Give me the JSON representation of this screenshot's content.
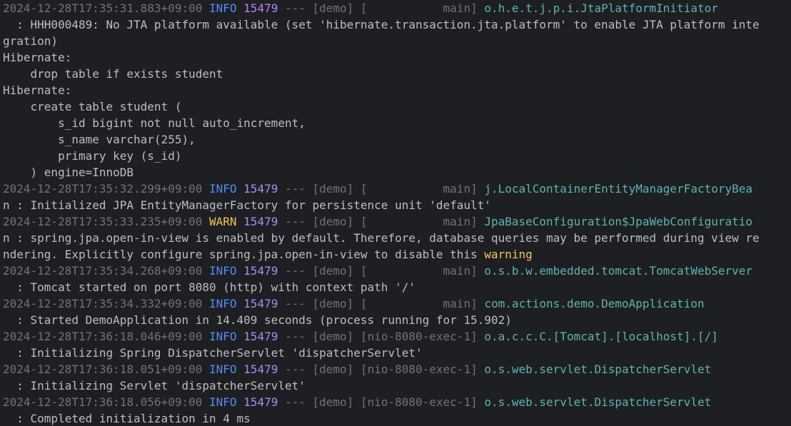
{
  "colors": {
    "background": "#1e1f22",
    "text": "#bcbec4",
    "timestamp": "#6f737a",
    "info": "#548af7",
    "warn": "#f2c55c",
    "pid": "#b189f5",
    "logger": "#5fb3b3"
  },
  "lines": [
    {
      "kind": "log",
      "ts": "2024-12-28T17:35:31.883+09:00",
      "level": "INFO",
      "level_pad": " INFO",
      "pid": "15479",
      "sep": "--- [demo] [",
      "thread": "           main]",
      "logger": "o.h.e.t.j.p.i.JtaPlatformInitiator"
    },
    {
      "kind": "text",
      "text": "  : HHH000489: No JTA platform available (set 'hibernate.transaction.jta.platform' to enable JTA platform inte"
    },
    {
      "kind": "text",
      "text": "gration)"
    },
    {
      "kind": "text",
      "text": "Hibernate:"
    },
    {
      "kind": "text",
      "text": "    drop table if exists student"
    },
    {
      "kind": "text",
      "text": "Hibernate:"
    },
    {
      "kind": "text",
      "text": "    create table student ("
    },
    {
      "kind": "text",
      "text": "        s_id bigint not null auto_increment,"
    },
    {
      "kind": "text",
      "text": "        s_name varchar(255),"
    },
    {
      "kind": "text",
      "text": "        primary key (s_id)"
    },
    {
      "kind": "text",
      "text": "    ) engine=InnoDB"
    },
    {
      "kind": "log",
      "ts": "2024-12-28T17:35:32.299+09:00",
      "level": "INFO",
      "level_pad": " INFO",
      "pid": "15479",
      "sep": "--- [demo] [",
      "thread": "           main]",
      "logger": "j.LocalContainerEntityManagerFactoryBea"
    },
    {
      "kind": "text",
      "text": "n : Initialized JPA EntityManagerFactory for persistence unit 'default'"
    },
    {
      "kind": "log",
      "ts": "2024-12-28T17:35:33.235+09:00",
      "level": "WARN",
      "level_pad": " WARN",
      "pid": "15479",
      "sep": "--- [demo] [",
      "thread": "           main]",
      "logger": "JpaBaseConfiguration$JpaWebConfiguratio"
    },
    {
      "kind": "text",
      "text": "n : spring.jpa.open-in-view is enabled by default. Therefore, database queries may be performed during view re"
    },
    {
      "kind": "textwarn",
      "text": "ndering. Explicitly configure spring.jpa.open-in-view to disable this ",
      "highlight": "warning"
    },
    {
      "kind": "log",
      "ts": "2024-12-28T17:35:34.268+09:00",
      "level": "INFO",
      "level_pad": " INFO",
      "pid": "15479",
      "sep": "--- [demo] [",
      "thread": "           main]",
      "logger": "o.s.b.w.embedded.tomcat.TomcatWebServer"
    },
    {
      "kind": "text",
      "text": "  : Tomcat started on port 8080 (http) with context path '/'"
    },
    {
      "kind": "log",
      "ts": "2024-12-28T17:35:34.332+09:00",
      "level": "INFO",
      "level_pad": " INFO",
      "pid": "15479",
      "sep": "--- [demo] [",
      "thread": "           main]",
      "logger": "com.actions.demo.DemoApplication"
    },
    {
      "kind": "text",
      "text": "  : Started DemoApplication in 14.409 seconds (process running for 15.902)"
    },
    {
      "kind": "log",
      "ts": "2024-12-28T17:36:18.046+09:00",
      "level": "INFO",
      "level_pad": " INFO",
      "pid": "15479",
      "sep": "--- [demo] [",
      "thread": "nio-8080-exec-1]",
      "logger": "o.a.c.c.C.[Tomcat].[localhost].[/]"
    },
    {
      "kind": "text",
      "text": "  : Initializing Spring DispatcherServlet 'dispatcherServlet'"
    },
    {
      "kind": "log",
      "ts": "2024-12-28T17:36:18.051+09:00",
      "level": "INFO",
      "level_pad": " INFO",
      "pid": "15479",
      "sep": "--- [demo] [",
      "thread": "nio-8080-exec-1]",
      "logger": "o.s.web.servlet.DispatcherServlet"
    },
    {
      "kind": "text",
      "text": "  : Initializing Servlet 'dispatcherServlet'"
    },
    {
      "kind": "log",
      "ts": "2024-12-28T17:36:18.056+09:00",
      "level": "INFO",
      "level_pad": " INFO",
      "pid": "15479",
      "sep": "--- [demo] [",
      "thread": "nio-8080-exec-1]",
      "logger": "o.s.web.servlet.DispatcherServlet"
    },
    {
      "kind": "text",
      "text": "  : Completed initialization in 4 ms"
    }
  ]
}
